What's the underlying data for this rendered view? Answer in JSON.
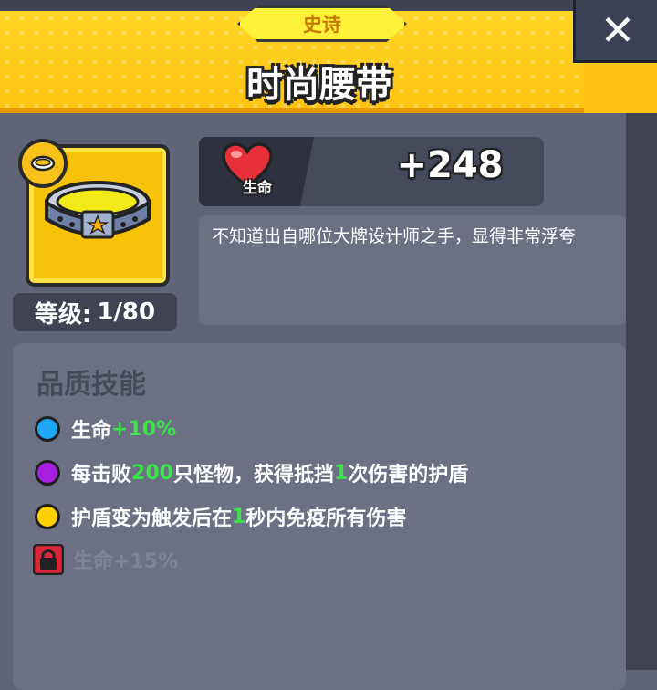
{
  "header": {
    "rarity": "史诗",
    "title": "时尚腰带",
    "close_symbol": "✕"
  },
  "item": {
    "icon": "belt-icon",
    "badge_icon": "belt-badge-icon",
    "level_label": "等级:",
    "level_value": "1/80"
  },
  "stat": {
    "icon": "heart-icon",
    "label": "生命",
    "value": "+248"
  },
  "description": "不知道出自哪位大牌设计师之手，显得非常浮夸",
  "skills": {
    "title": "品质技能",
    "items": [
      {
        "color": "#1ea7f5",
        "parts": [
          "生命",
          "+10%",
          ""
        ]
      },
      {
        "color": "#a51fe0",
        "parts": [
          "每击败",
          "200",
          "只怪物，获得抵挡",
          "1",
          "次伤害的护盾"
        ]
      },
      {
        "color": "#ffd000",
        "parts": [
          "护盾变为触发后在",
          "1",
          "秒内免疫所有伤害"
        ]
      },
      {
        "locked": true,
        "icon": "lock-icon",
        "text": "生命+15%"
      }
    ]
  },
  "colors": {
    "header": "#ffc414",
    "panel": "#6b7085",
    "highlight": "#3be34a"
  }
}
